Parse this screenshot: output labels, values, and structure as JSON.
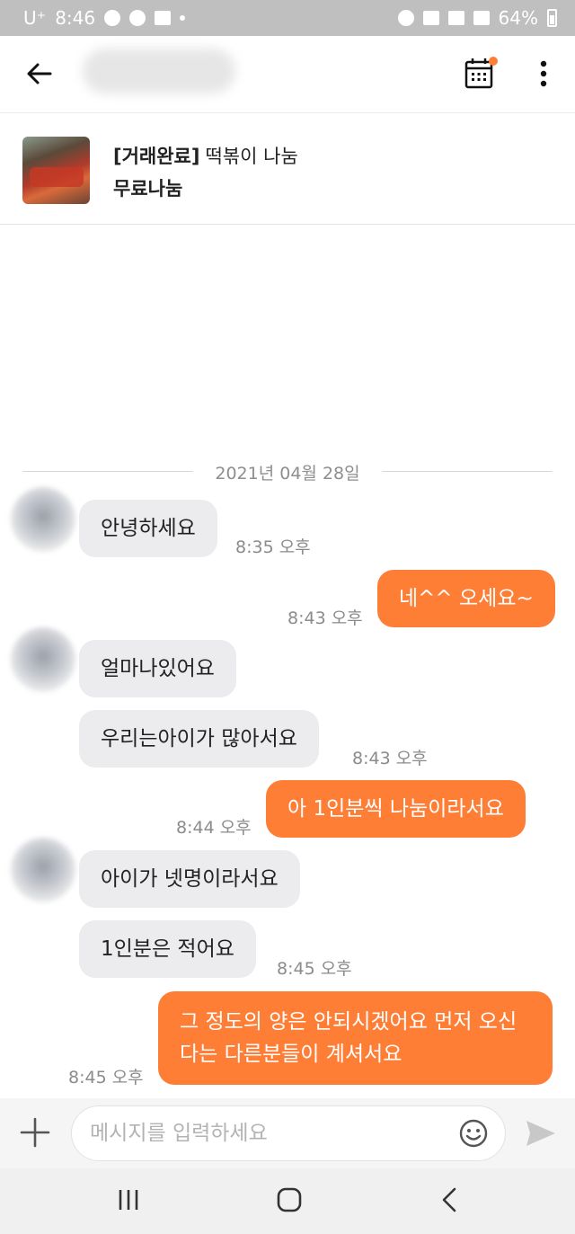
{
  "status_bar": {
    "carrier": "U⁺",
    "time": "8:46",
    "battery": "64%"
  },
  "header": {
    "back_icon": "arrow-left-icon",
    "calendar_icon": "calendar-icon",
    "more_icon": "more-vertical-icon",
    "notification_dot_color": "#ff7e36"
  },
  "product": {
    "status": "[거래완료]",
    "title": "떡볶이 나눔",
    "price": "무료나눔"
  },
  "chat": {
    "date": "2021년 04월 28일",
    "messages": [
      {
        "side": "in",
        "text": "안녕하세요",
        "time": "8:35 오후"
      },
      {
        "side": "out",
        "text": "네^^ 오세요~",
        "time": "8:43 오후"
      },
      {
        "side": "in",
        "text": "얼마나있어요",
        "time": ""
      },
      {
        "side": "in",
        "text": "우리는아이가 많아서요",
        "time": "8:43 오후"
      },
      {
        "side": "out",
        "text": "아 1인분씩 나눔이라서요",
        "time": "8:44 오후"
      },
      {
        "side": "in",
        "text": "아이가 넷명이라서요",
        "time": ""
      },
      {
        "side": "in",
        "text": "1인분은 적어요",
        "time": "8:45 오후"
      },
      {
        "side": "out",
        "text": "그 정도의 양은 안되시겠어요 먼저 오신다는 다른분들이 계셔서요",
        "time": "8:45 오후"
      }
    ]
  },
  "input": {
    "placeholder": "메시지를 입력하세요",
    "plus_icon": "plus-icon",
    "emoji_icon": "emoji-icon",
    "send_icon": "send-icon"
  },
  "colors": {
    "accent": "#ff7e36",
    "incoming_bubble": "#ececef",
    "timestamp": "#8b8b8b"
  }
}
